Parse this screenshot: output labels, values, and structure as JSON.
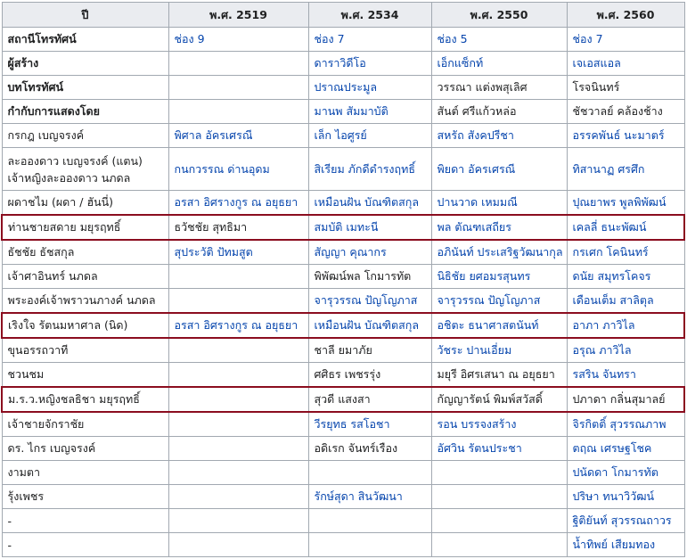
{
  "headers": [
    "ปี",
    "พ.ศ. 2519",
    "พ.ศ. 2534",
    "พ.ศ. 2550",
    "พ.ศ. 2560"
  ],
  "rows": [
    {
      "role": "สถานีโทรทัศน์",
      "bold": true,
      "cells": [
        {
          "t": "ช่อง 9",
          "link": true
        },
        {
          "t": "ช่อง 7",
          "link": true
        },
        {
          "t": "ช่อง 5",
          "link": true
        },
        {
          "t": "ช่อง 7",
          "link": true
        }
      ]
    },
    {
      "role": "ผู้สร้าง",
      "bold": true,
      "cells": [
        {
          "t": "",
          "link": false
        },
        {
          "t": "ดาราวิดีโอ",
          "link": true
        },
        {
          "t": "เอ็กแซ็กท์",
          "link": true
        },
        {
          "t": "เจเอสแอล",
          "link": true
        }
      ]
    },
    {
      "role": "บทโทรทัศน์",
      "bold": true,
      "cells": [
        {
          "t": "",
          "link": false
        },
        {
          "t": "ปราณประมูล",
          "link": true
        },
        {
          "t": "วรรณา แต่งพสุเลิศ",
          "link": false
        },
        {
          "t": "โรจนินทร์",
          "link": false
        }
      ]
    },
    {
      "role": "กำกับการแสดงโดย",
      "bold": true,
      "cells": [
        {
          "t": "",
          "link": false
        },
        {
          "t": "มานพ สัมมาบัติ",
          "link": true
        },
        {
          "t": "สันต์ ศรีแก้วหล่อ",
          "link": false
        },
        {
          "t": "ชัชวาลย์ คล้องช้าง",
          "link": false
        }
      ]
    },
    {
      "role": "กรกฎ เบญจรงค์",
      "bold": false,
      "cells": [
        {
          "t": "พิศาล อัครเศรณี",
          "link": true
        },
        {
          "t": "เล็ก ไอศูรย์",
          "link": true
        },
        {
          "t": "สหรัถ สังคปรีชา",
          "link": true
        },
        {
          "t": "อรรคพันธ์ นะมาตร์",
          "link": true
        }
      ]
    },
    {
      "role": "ละอองดาว เบญจรงค์ (แตน) เจ้าหญิงละอองดาว นภดล",
      "bold": false,
      "tall": true,
      "cells": [
        {
          "t": "กนกวรรณ ด่านอุดม",
          "link": true
        },
        {
          "t": "สิเรียม ภักดีดำรงฤทธิ์",
          "link": true
        },
        {
          "t": "พิยดา อัครเศรณี",
          "link": true
        },
        {
          "t": "ทิสานาฏ ศรศึก",
          "link": true
        }
      ]
    },
    {
      "role": "ผดาชไม (ผดา / ฮันนี่)",
      "bold": false,
      "cells": [
        {
          "t": "อรสา อิศรางกูร ณ อยุธยา",
          "link": true
        },
        {
          "t": "เหมือนฝัน บัณฑิตสกุล",
          "link": true
        },
        {
          "t": "ปานวาด เหมมณี",
          "link": true
        },
        {
          "t": "ปุณยาพร พูลพิพัฒน์",
          "link": true
        }
      ]
    },
    {
      "role": "ท่านชายสดาย มยุรฤทธิ์",
      "bold": false,
      "hl": true,
      "cells": [
        {
          "t": "ธวัชชัย สุทธิมา",
          "link": false
        },
        {
          "t": "สมบัติ เมทะนี",
          "link": true
        },
        {
          "t": "พล ตัณฑเสถียร",
          "link": true
        },
        {
          "t": "เคลลี่ ธนะพัฒน์",
          "link": true
        }
      ]
    },
    {
      "role": "ธัชชัย ธัชสกุล",
      "bold": false,
      "cells": [
        {
          "t": "สุประวัติ ปัทมสูต",
          "link": true
        },
        {
          "t": "สัญญา คุณากร",
          "link": true
        },
        {
          "t": "อภินันท์ ประเสริฐวัฒนากุล",
          "link": true
        },
        {
          "t": "กรเศก โคนินทร์",
          "link": true
        }
      ]
    },
    {
      "role": "เจ้าศาอินทร์ นภดล",
      "bold": false,
      "cells": [
        {
          "t": "",
          "link": false
        },
        {
          "t": "พิพัฒน์พล โกมารทัต",
          "link": false
        },
        {
          "t": "นิธิชัย ยศอมรสุนทร",
          "link": true
        },
        {
          "t": "ดนัย สมุทรโคจร",
          "link": true
        }
      ]
    },
    {
      "role": "พระองค์เจ้าพราวนภางค์ นภดล",
      "bold": false,
      "cells": [
        {
          "t": "",
          "link": false
        },
        {
          "t": "จารุวรรณ ปัญโญภาส",
          "link": true
        },
        {
          "t": "จารุวรรณ ปัญโญภาส",
          "link": true
        },
        {
          "t": "เดือนเต็ม สาลิตุล",
          "link": true
        }
      ]
    },
    {
      "role": "เริงใจ รัตนมหาศาล (นิด)",
      "bold": false,
      "hl": true,
      "cells": [
        {
          "t": "อรสา อิศรางกูร ณ อยุธยา",
          "link": true
        },
        {
          "t": "เหมือนฝัน บัณฑิตสกุล",
          "link": true
        },
        {
          "t": "อชิตะ ธนาศาสตนันท์",
          "link": true
        },
        {
          "t": "อาภา ภาวิไล",
          "link": true
        }
      ]
    },
    {
      "role": "ขุนอรรถวาที",
      "bold": false,
      "cells": [
        {
          "t": "",
          "link": false
        },
        {
          "t": "ชาลี ยมาภัย",
          "link": false
        },
        {
          "t": "วัชระ ปานเอี่ยม",
          "link": true
        },
        {
          "t": "อรุณ ภาวิไล",
          "link": true
        }
      ]
    },
    {
      "role": "ชวนชม",
      "bold": false,
      "cells": [
        {
          "t": "",
          "link": false
        },
        {
          "t": "ศศิธร เพชรรุ่ง",
          "link": false
        },
        {
          "t": "มยุรี อิศรเสนา ณ อยุธยา",
          "link": false
        },
        {
          "t": "รสริน จันทรา",
          "link": true
        }
      ]
    },
    {
      "role": "ม.ร.ว.หญิงชลธิชา มยุรฤทธิ์",
      "bold": false,
      "hl": true,
      "cells": [
        {
          "t": "",
          "link": false
        },
        {
          "t": "สุวดี แสงสา",
          "link": false
        },
        {
          "t": "กัญญารัตน์ พิมพ์สวัสดิ์",
          "link": false
        },
        {
          "t": "ปภาดา กลิ่นสุมาลย์",
          "link": false
        }
      ]
    },
    {
      "role": "เจ้าชายจักราชัย",
      "bold": false,
      "cells": [
        {
          "t": "",
          "link": false
        },
        {
          "t": "วีรยุทธ รสโอชา",
          "link": true
        },
        {
          "t": "รอน บรรจงสร้าง",
          "link": true
        },
        {
          "t": "จิรกิตติ์ สุวรรณภาพ",
          "link": true
        }
      ]
    },
    {
      "role": "ดร. ไกร เบญจรงค์",
      "bold": false,
      "cells": [
        {
          "t": "",
          "link": false
        },
        {
          "t": "อดิเรก จันทร์เรือง",
          "link": false
        },
        {
          "t": "อัศวิน รัตนประชา",
          "link": true
        },
        {
          "t": "ตฤณ เศรษฐโชค",
          "link": true
        }
      ]
    },
    {
      "role": "งามตา",
      "bold": false,
      "cells": [
        {
          "t": "",
          "link": false
        },
        {
          "t": "",
          "link": false
        },
        {
          "t": "",
          "link": false
        },
        {
          "t": "ปนัดดา โกมารทัต",
          "link": true
        }
      ]
    },
    {
      "role": "รุ้งเพชร",
      "bold": false,
      "cells": [
        {
          "t": "",
          "link": false
        },
        {
          "t": "รักษ์สุดา สินวัฒนา",
          "link": true
        },
        {
          "t": "",
          "link": false
        },
        {
          "t": "ปริษา ทนาวิวัฒน์",
          "link": true
        }
      ]
    },
    {
      "role": "-",
      "bold": false,
      "cells": [
        {
          "t": "",
          "link": false
        },
        {
          "t": "",
          "link": false
        },
        {
          "t": "",
          "link": false
        },
        {
          "t": "ฐิติยันท์ สุวรรณถาวร",
          "link": true
        }
      ]
    },
    {
      "role": "-",
      "bold": false,
      "cells": [
        {
          "t": "",
          "link": false
        },
        {
          "t": "",
          "link": false
        },
        {
          "t": "",
          "link": false
        },
        {
          "t": "น้ำทิพย์ เสียมทอง",
          "link": true
        }
      ]
    }
  ]
}
